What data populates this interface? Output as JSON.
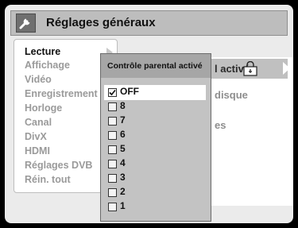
{
  "title": "Réglages généraux",
  "left_menu": {
    "items": [
      {
        "label": "Lecture",
        "active": true
      },
      {
        "label": "Affichage",
        "active": false
      },
      {
        "label": "Vidéo",
        "active": false
      },
      {
        "label": "Enregistrement",
        "active": false
      },
      {
        "label": "Horloge",
        "active": false
      },
      {
        "label": "Canal",
        "active": false
      },
      {
        "label": "DivX",
        "active": false
      },
      {
        "label": "HDMI",
        "active": false
      },
      {
        "label": "Réglages DVB",
        "active": false
      },
      {
        "label": "Réin. tout",
        "active": false
      }
    ]
  },
  "right_menu": {
    "highlighted_partial": "l activé",
    "partial_2": "disque",
    "partial_3": "es"
  },
  "popup": {
    "title": "Contrôle parental activé",
    "options": [
      {
        "label": "OFF",
        "checked": true
      },
      {
        "label": "8",
        "checked": false
      },
      {
        "label": "7",
        "checked": false
      },
      {
        "label": "6",
        "checked": false
      },
      {
        "label": "5",
        "checked": false
      },
      {
        "label": "4",
        "checked": false
      },
      {
        "label": "3",
        "checked": false
      },
      {
        "label": "2",
        "checked": false
      },
      {
        "label": "1",
        "checked": false
      }
    ]
  },
  "icons": {
    "title_icon": "wrench-icon",
    "lock_icon": "parental-lock-icon"
  },
  "colors": {
    "background": "#000000",
    "panel": "#ebebeb",
    "title_bar": "#bdbdbd",
    "popup": "#c3c3c3",
    "highlight_row": "#c0c0c0"
  }
}
